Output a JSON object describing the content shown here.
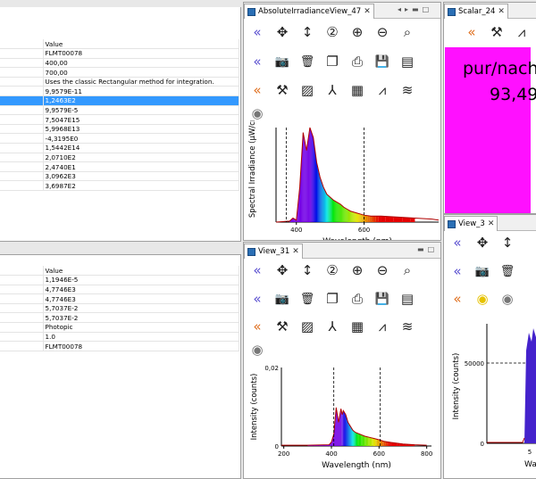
{
  "props1": {
    "header": "Value",
    "rows": [
      "FLMT00078",
      "400,00",
      "700,00",
      "Uses the classic Rectangular method for integration.",
      "9,9579E-11",
      "1,2463E2",
      "9,9579E-5",
      "7,5047E15",
      "5,9968E13",
      "-4,3195E0",
      "1,5442E14",
      "2,0710E2",
      "2,4740E1",
      "3,0962E3",
      "3,6987E2"
    ],
    "selected_index": 5
  },
  "props2": {
    "header": "Value",
    "rows": [
      "1,1946E-5",
      "4,7746E3",
      "4,7746E3",
      "5,7037E-2",
      "5,7037E-2",
      "Photopic",
      "1.0",
      "FLMT00078"
    ]
  },
  "view_abs": {
    "tab_label": "AbsoluteIrradianceView_47",
    "close": "✕",
    "chart_data": {
      "type": "line",
      "xlabel": "Wavelength (nm)",
      "ylabel": "Spectral Irradiance (μW/cm",
      "x_ticks": [
        "400",
        "600"
      ],
      "x_markers": [
        370,
        600
      ],
      "xlim": [
        340,
        820
      ],
      "x": [
        340,
        380,
        390,
        400,
        410,
        420,
        430,
        440,
        450,
        460,
        470,
        480,
        490,
        500,
        510,
        520,
        530,
        540,
        550,
        560,
        570,
        580,
        590,
        600,
        620,
        650,
        700,
        750,
        800,
        820
      ],
      "y": [
        0,
        0.01,
        0.04,
        0.02,
        0.35,
        0.9,
        0.72,
        0.95,
        0.85,
        0.6,
        0.45,
        0.35,
        0.28,
        0.25,
        0.22,
        0.2,
        0.18,
        0.15,
        0.13,
        0.11,
        0.1,
        0.09,
        0.08,
        0.07,
        0.06,
        0.06,
        0.05,
        0.04,
        0.03,
        0.02
      ]
    }
  },
  "view31": {
    "tab_label": "View_31",
    "close": "✕",
    "chart_data": {
      "type": "line",
      "xlabel": "Wavelength (nm)",
      "ylabel": "Intensity (counts)",
      "x_ticks": [
        "200",
        "400",
        "600",
        "800"
      ],
      "y_ticks": [
        "0",
        "0,02"
      ],
      "x_markers": [
        410,
        605
      ],
      "xlim": [
        190,
        820
      ],
      "ylim": [
        0,
        0.02
      ],
      "x": [
        190,
        300,
        390,
        400,
        410,
        420,
        430,
        440,
        445,
        450,
        460,
        470,
        480,
        490,
        500,
        520,
        540,
        560,
        580,
        600,
        620,
        650,
        700,
        750,
        800
      ],
      "y": [
        0.0002,
        0.0002,
        0.0003,
        0.001,
        0.003,
        0.0098,
        0.006,
        0.0095,
        0.008,
        0.009,
        0.008,
        0.006,
        0.005,
        0.004,
        0.0035,
        0.003,
        0.0025,
        0.0022,
        0.0019,
        0.0016,
        0.0012,
        0.0009,
        0.0005,
        0.0003,
        0.0002
      ]
    }
  },
  "scalar": {
    "tab_label": "Scalar_24",
    "close": "✕",
    "line1": "pur/nach",
    "line2": "93,49"
  },
  "view3": {
    "tab_label": "View_3",
    "close": "✕",
    "chart_data": {
      "type": "line",
      "ylabel": "Intensity (counts)",
      "y_ticks": [
        "0",
        "50000"
      ],
      "xlabel": "Wav",
      "x_ticks": [
        "5"
      ]
    }
  },
  "toolbar_glyphs": {
    "back": "«",
    "move": "✥",
    "updown": "↕",
    "zoom_reset": "②",
    "zoom_in": "⊕",
    "zoom_out": "⊖",
    "search": "⌕",
    "camera": "📷",
    "trash": "🗑",
    "copy": "❐",
    "print": "⎙",
    "save": "💾",
    "book": "▤",
    "tools": "⚒",
    "chart": "▨",
    "figure": "⅄",
    "table": "▦",
    "peak": "⩘",
    "wave": "≋",
    "bulb": "◉"
  }
}
